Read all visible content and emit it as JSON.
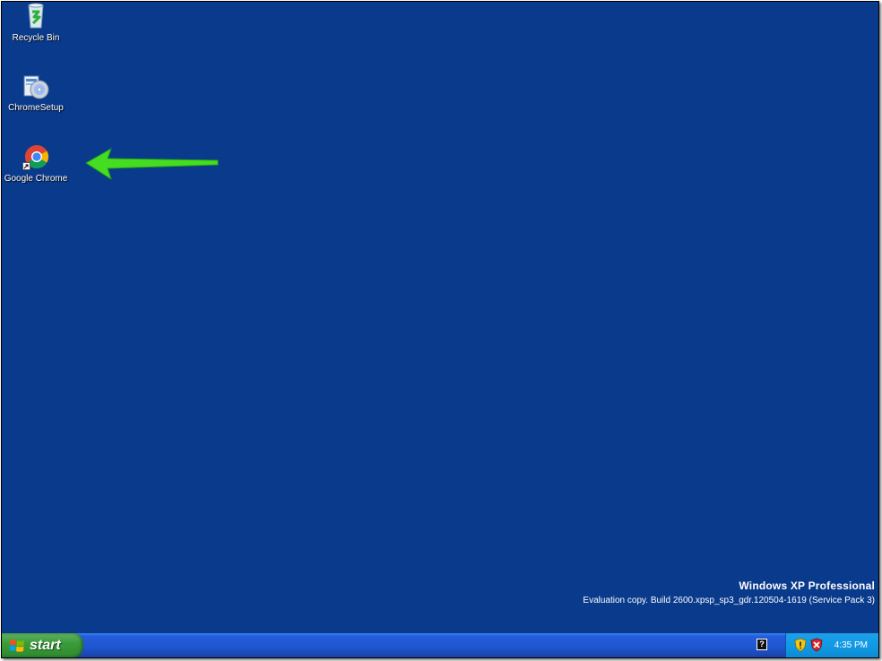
{
  "desktop": {
    "background": "#0a3a8c",
    "icons": [
      {
        "label": "Recycle Bin",
        "icon": "recycle-bin-icon"
      },
      {
        "label": "ChromeSetup",
        "icon": "setup-installer-icon"
      },
      {
        "label": "Google Chrome",
        "icon": "chrome-icon"
      }
    ]
  },
  "watermark": {
    "title": "Windows XP Professional",
    "subtitle": "Evaluation copy. Build 2600.xpsp_sp3_gdr.120504-1619 (Service Pack 3)"
  },
  "taskbar": {
    "start_label": "start",
    "help_glyph": "?",
    "tray": {
      "icons": [
        "security-shield-icon",
        "antivirus-shield-icon"
      ],
      "clock": "4:35 PM"
    }
  },
  "colors": {
    "taskbar_blue": "#245edb",
    "start_green": "#3c9c3c",
    "tray_blue": "#129ae4",
    "arrow_green": "#44dd22"
  }
}
